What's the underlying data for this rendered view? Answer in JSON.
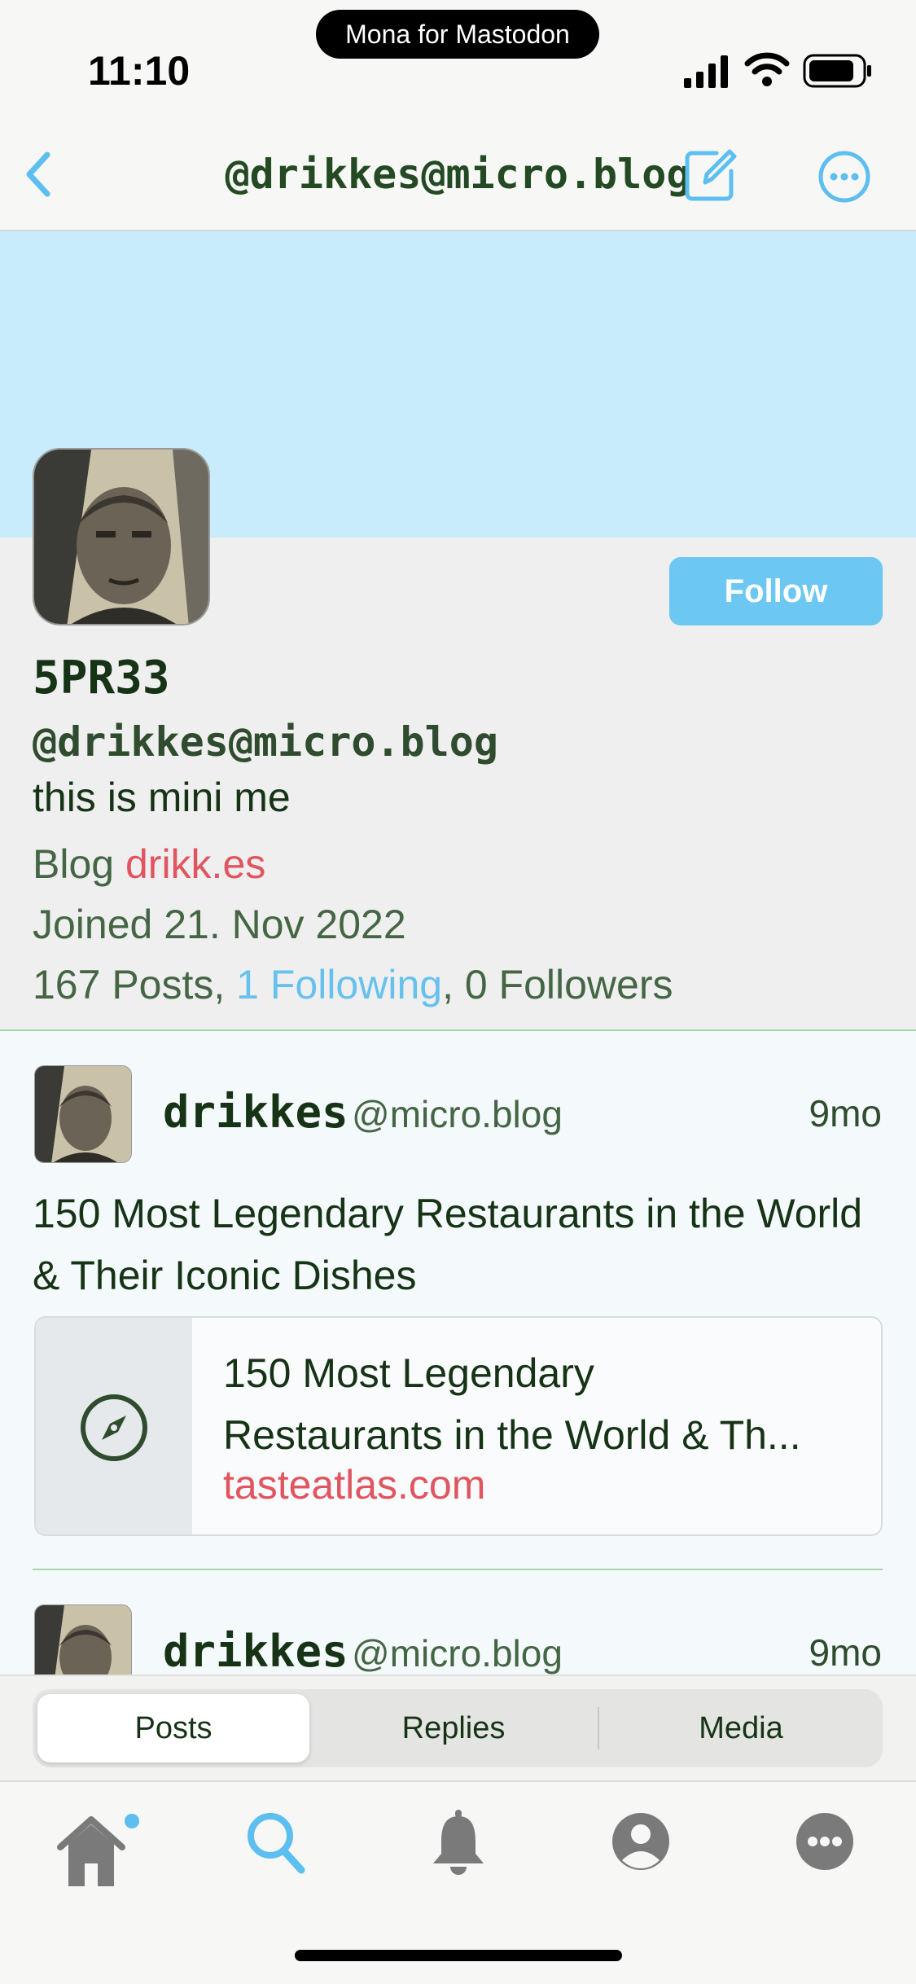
{
  "status_bar": {
    "time": "11:10",
    "app_label": "Mona for Mastodon"
  },
  "nav": {
    "title": "@drikkes@micro.blog",
    "back_icon": "chevron-left-icon",
    "compose_icon": "compose-icon",
    "more_icon": "ellipsis-circle-icon"
  },
  "profile": {
    "display_name": "5PR33",
    "handle": "@drikkes@micro.blog",
    "bio": "this is mini me",
    "blog_label": "Blog",
    "blog_link": "drikk.es",
    "joined": "Joined 21. Nov 2022",
    "posts": "167 Posts, ",
    "following": "1 Following",
    "followers": ", 0 Followers",
    "follow_button": "Follow"
  },
  "posts": [
    {
      "name": "drikkes",
      "server": "@micro.blog",
      "time": "9mo",
      "text": "150 Most Legendary Restaurants in the World & Their Iconic Dishes",
      "card": {
        "title_line1": "150 Most Legendary",
        "title_line2": "Restaurants in the World & Th...",
        "domain": "tasteatlas.com",
        "icon": "compass-icon"
      }
    },
    {
      "name": "drikkes",
      "server": "@micro.blog",
      "time": "9mo"
    }
  ],
  "segments": [
    "Posts",
    "Replies",
    "Media"
  ],
  "tabbar": [
    "home-icon",
    "search-icon",
    "bell-icon",
    "profile-icon",
    "more-icon"
  ],
  "colors": {
    "accent": "#66c1ee",
    "link": "#e0555f",
    "text": "#163316",
    "banner": "#c8ecfb"
  }
}
